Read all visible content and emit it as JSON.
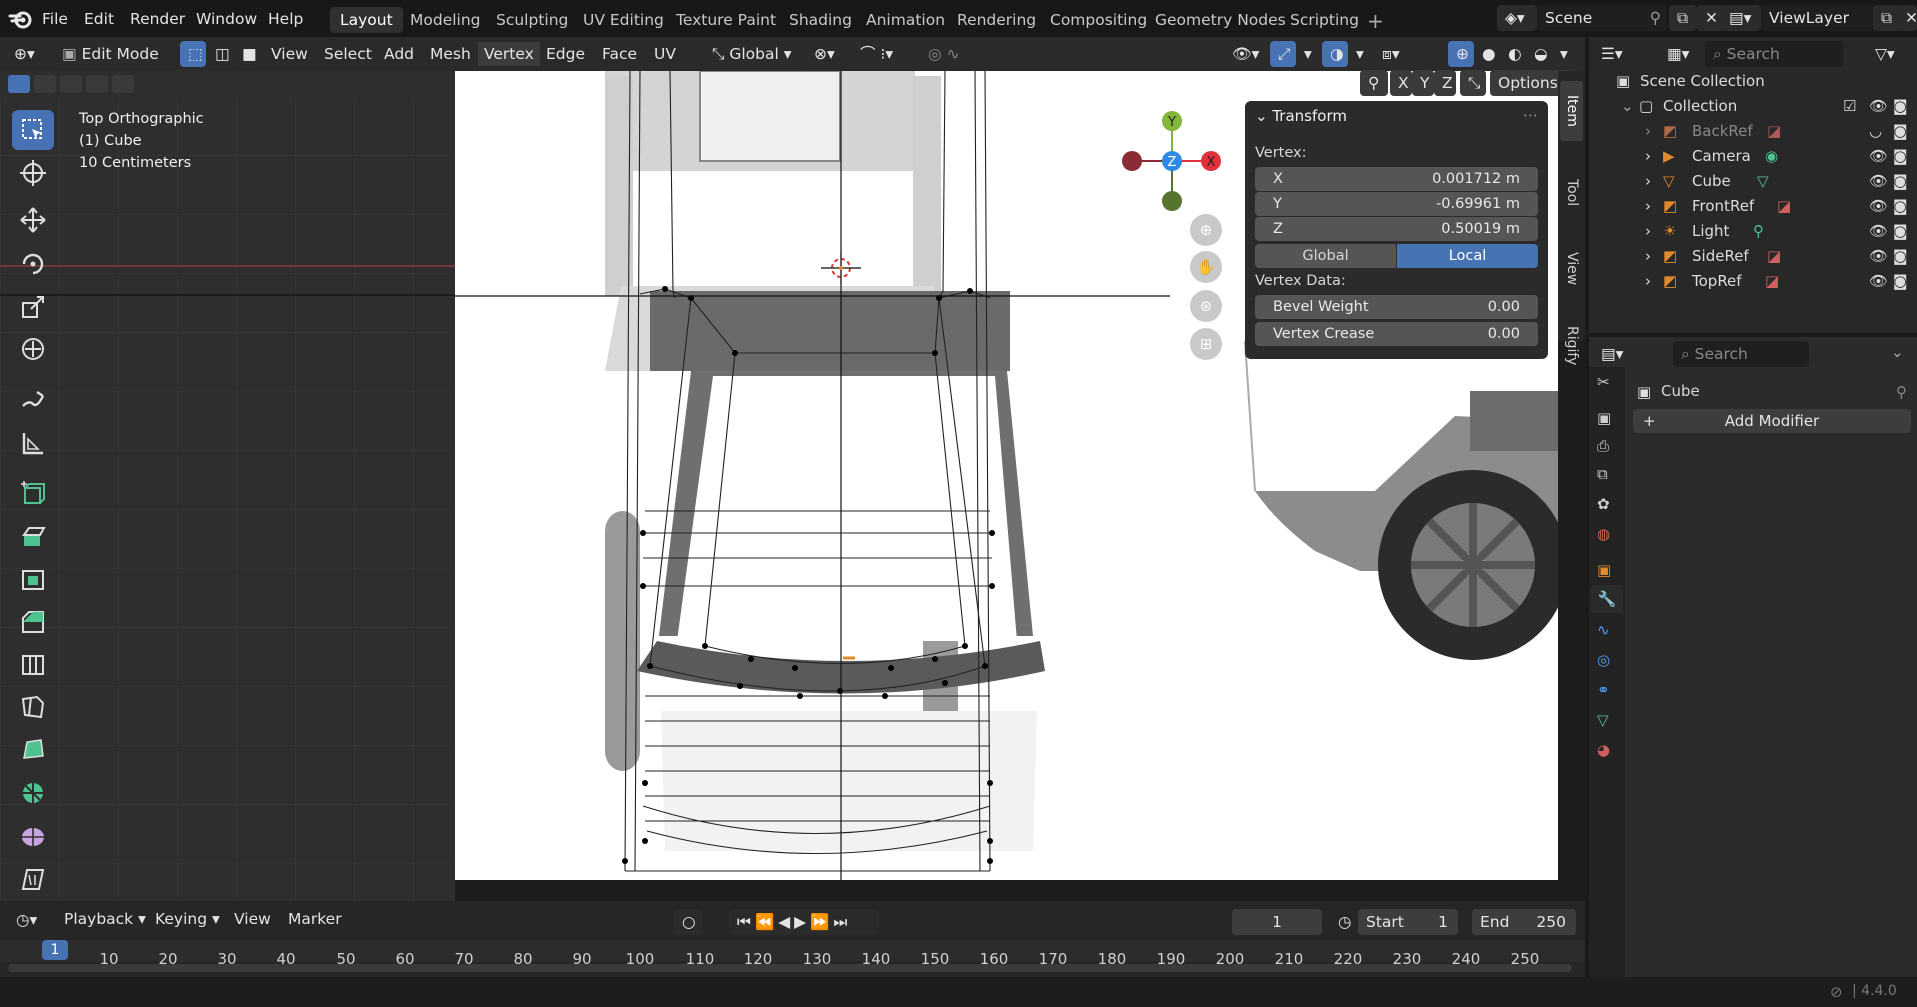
{
  "menus": {
    "file": "File",
    "edit": "Edit",
    "render": "Render",
    "window": "Window",
    "help": "Help"
  },
  "workspaces": [
    "Layout",
    "Modeling",
    "Sculpting",
    "UV Editing",
    "Texture Paint",
    "Shading",
    "Animation",
    "Rendering",
    "Compositing",
    "Geometry Nodes",
    "Scripting"
  ],
  "active_workspace": "Layout",
  "scene": {
    "name": "Scene"
  },
  "viewlayer": {
    "name": "ViewLayer"
  },
  "viewport_header": {
    "mode": "Edit Mode",
    "menus": [
      "View",
      "Select",
      "Add",
      "Mesh",
      "Vertex",
      "Edge",
      "Face",
      "UV"
    ],
    "orientation": "Global",
    "options_label": "Options",
    "axes": [
      "X",
      "Y",
      "Z"
    ]
  },
  "viewport_info": {
    "line1": "Top Orthographic",
    "line2": "(1) Cube",
    "line3": "10 Centimeters"
  },
  "transform_panel": {
    "title": "Transform",
    "vertex_label": "Vertex:",
    "x_label": "X",
    "x_value": "0.001712 m",
    "y_label": "Y",
    "y_value": "-0.69961 m",
    "z_label": "Z",
    "z_value": "0.50019 m",
    "global_label": "Global",
    "local_label": "Local",
    "vertex_data_label": "Vertex Data:",
    "bevel_label": "Bevel Weight",
    "bevel_value": "0.00",
    "crease_label": "Vertex Crease",
    "crease_value": "0.00"
  },
  "side_tabs": [
    "Item",
    "Tool",
    "View",
    "Rigify"
  ],
  "gizmo": {
    "x": "X",
    "y": "Y",
    "z": "Z"
  },
  "outliner": {
    "search_placeholder": "Search",
    "root": "Scene Collection",
    "collection": "Collection",
    "items": [
      "BackRef",
      "Camera",
      "Cube",
      "FrontRef",
      "Light",
      "SideRef",
      "TopRef"
    ]
  },
  "properties": {
    "search_placeholder": "Search",
    "object_name": "Cube",
    "add_modifier": "Add Modifier"
  },
  "timeline": {
    "playback": "Playback",
    "keying": "Keying",
    "view": "View",
    "marker": "Marker",
    "current_frame": "1",
    "start_label": "Start",
    "start_value": "1",
    "end_label": "End",
    "end_value": "250",
    "ruler": [
      "1",
      "10",
      "20",
      "30",
      "40",
      "50",
      "60",
      "70",
      "80",
      "90",
      "100",
      "110",
      "120",
      "130",
      "140",
      "150",
      "160",
      "170",
      "180",
      "190",
      "200",
      "210",
      "220",
      "230",
      "240",
      "250"
    ]
  },
  "status": {
    "version": "4.4.0"
  },
  "colors": {
    "accent": "#4772b3",
    "x_axis": "#e0313d",
    "y_axis": "#82b53a",
    "z_axis": "#2e8ae6",
    "background": "#2e2e2e"
  }
}
